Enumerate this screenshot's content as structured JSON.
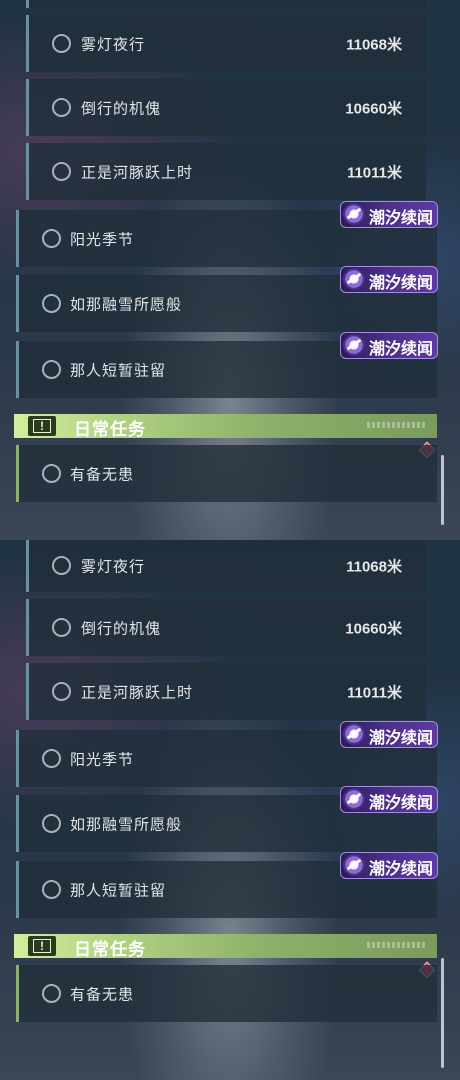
{
  "screens": [
    {
      "quests": [
        {
          "name": "雾灯夜行",
          "distance": "11068米"
        },
        {
          "name": "倒行的机傀",
          "distance": "10660米"
        },
        {
          "name": "正是河豚跃上时",
          "distance": "11011米"
        },
        {
          "name": "阳光季节",
          "tag": "潮汐续闻"
        },
        {
          "name": "如那融雪所愿般",
          "tag": "潮汐续闻"
        },
        {
          "name": "那人短暂驻留",
          "tag": "潮汐续闻"
        }
      ],
      "daily_section": {
        "title": "日常任务",
        "icon_glyph": "!"
      },
      "daily_quests": [
        {
          "name": "有备无患"
        }
      ]
    },
    {
      "quests": [
        {
          "name": "雾灯夜行",
          "distance": "11068米"
        },
        {
          "name": "倒行的机傀",
          "distance": "10660米"
        },
        {
          "name": "正是河豚跃上时",
          "distance": "11011米"
        },
        {
          "name": "阳光季节",
          "tag": "潮汐续闻"
        },
        {
          "name": "如那融雪所愿般",
          "tag": "潮汐续闻"
        },
        {
          "name": "那人短暂驻留",
          "tag": "潮汐续闻"
        }
      ],
      "daily_section": {
        "title": "日常任务",
        "icon_glyph": "!"
      },
      "daily_quests": [
        {
          "name": "有备无患"
        }
      ]
    }
  ],
  "icons": {
    "quest_status": "radio-circle-icon",
    "tag": "tidal-wave-icon",
    "section": "exclamation-icon",
    "new_marker": "red-diamond-icon"
  },
  "colors": {
    "normal_accent": "#6d8fa2",
    "daily_accent": "#8fb073",
    "tag_purple": "#5e3aa3",
    "marker_red": "#d1475a"
  }
}
